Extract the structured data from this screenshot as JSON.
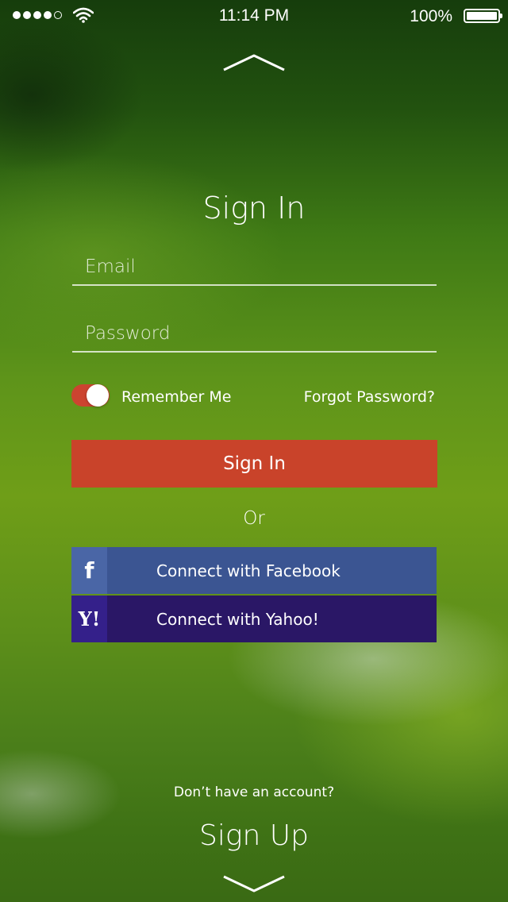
{
  "status_bar": {
    "time": "11:14 PM",
    "battery_percent": "100%",
    "signal_bars_filled": 4,
    "signal_bars_total": 5
  },
  "signin": {
    "title": "Sign In",
    "email_placeholder": "Email",
    "password_placeholder": "Password",
    "remember_label": "Remember Me",
    "remember_on": true,
    "forgot_label": "Forgot Password?",
    "button_label": "Sign In",
    "or_label": "Or"
  },
  "social": {
    "facebook_label": "Connect with Facebook",
    "facebook_icon_text": "f",
    "yahoo_label": "Connect with Yahoo!",
    "yahoo_icon_text": "Y!"
  },
  "signup": {
    "prompt": "Don’t have an account?",
    "link_label": "Sign Up"
  },
  "colors": {
    "accent": "#c9432a",
    "facebook": "#3b5592",
    "yahoo": "#2a1766"
  },
  "icons": {
    "top": "chevron-up-icon",
    "bottom": "chevron-down-icon",
    "wifi": "wifi-icon",
    "battery": "battery-icon"
  }
}
